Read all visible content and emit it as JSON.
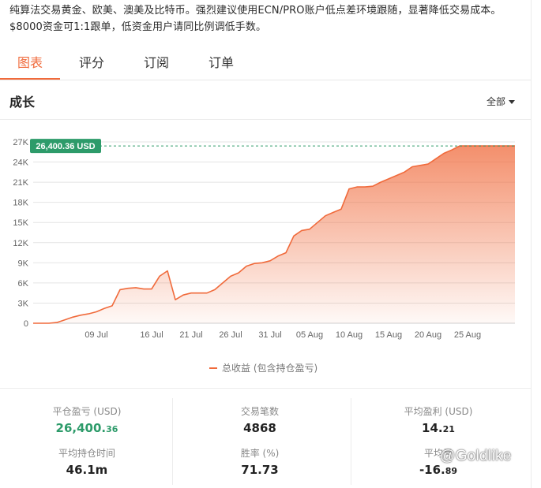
{
  "description": "纯算法交易黄金、欧美、澳美及比特币。强烈建议使用ECN/PRO账户低点差环境跟随，显著降低交易成本。$8000资金可1:1跟单，低资金用户请同比例调低手数。",
  "tabs": [
    {
      "label": "图表",
      "active": true
    },
    {
      "label": "评分",
      "active": false
    },
    {
      "label": "订阅",
      "active": false
    },
    {
      "label": "订单",
      "active": false
    }
  ],
  "section": {
    "title": "成长",
    "filter_label": "全部"
  },
  "chart_data": {
    "type": "area",
    "current_label": "26,400.36 USD",
    "current_value": 26400.36,
    "y_ticks": [
      "0",
      "3K",
      "6K",
      "9K",
      "12K",
      "15K",
      "18K",
      "21K",
      "24K",
      "27K"
    ],
    "ylim": [
      0,
      27000
    ],
    "x_ticks": [
      "09 Jul",
      "16 Jul",
      "21 Jul",
      "26 Jul",
      "31 Jul",
      "05 Aug",
      "10 Aug",
      "15 Aug",
      "20 Aug",
      "25 Aug"
    ],
    "x_tick_days": [
      8,
      15,
      20,
      25,
      30,
      35,
      40,
      45,
      50,
      55
    ],
    "xlim": [
      0,
      61
    ],
    "grid": true,
    "legend": "总收益 (包含持仓盈亏)",
    "series": [
      {
        "name": "总收益 (包含持仓盈亏)",
        "color": "#f06a3b",
        "x": [
          0,
          2,
          3,
          4,
          5,
          6,
          7,
          8,
          9,
          10,
          11,
          12,
          13,
          14,
          15,
          16,
          17,
          18,
          19,
          20,
          21,
          22,
          23,
          24,
          25,
          26,
          27,
          28,
          29,
          30,
          31,
          32,
          33,
          34,
          35,
          36,
          37,
          38,
          39,
          40,
          41,
          42,
          43,
          44,
          45,
          46,
          47,
          48,
          49,
          50,
          51,
          52,
          53,
          54,
          55,
          56,
          57,
          58,
          59,
          60,
          61
        ],
        "y": [
          0,
          0,
          100,
          500,
          900,
          1200,
          1400,
          1700,
          2200,
          2600,
          5000,
          5200,
          5300,
          5100,
          5100,
          7000,
          7800,
          3500,
          4200,
          4500,
          4500,
          4500,
          5000,
          6000,
          7000,
          7500,
          8500,
          8900,
          9000,
          9300,
          10000,
          10500,
          13000,
          13800,
          14000,
          15000,
          16000,
          16500,
          17000,
          20000,
          20300,
          20300,
          20400,
          21000,
          21500,
          22000,
          22500,
          23300,
          23500,
          23700,
          24500,
          25300,
          25800,
          26400,
          26400,
          26400,
          26400,
          26400,
          26400,
          26400,
          26400
        ]
      }
    ]
  },
  "stats": {
    "closed_pl_label": "平仓盈亏 (USD)",
    "closed_pl_int": "26,400.",
    "closed_pl_frac": "36",
    "trades_label": "交易笔数",
    "trades_value": "4868",
    "avg_profit_label": "平均盈利 (USD)",
    "avg_profit_int": "14.",
    "avg_profit_frac": "21",
    "avg_hold_label": "平均持仓时间",
    "avg_hold_value": "46.1m",
    "winrate_label": "胜率 (%)",
    "winrate_value": "71.73",
    "avg_loss_label": "平均亏",
    "avg_loss_int": "-16.",
    "avg_loss_frac": "89"
  },
  "watermark": "@Goldlike"
}
